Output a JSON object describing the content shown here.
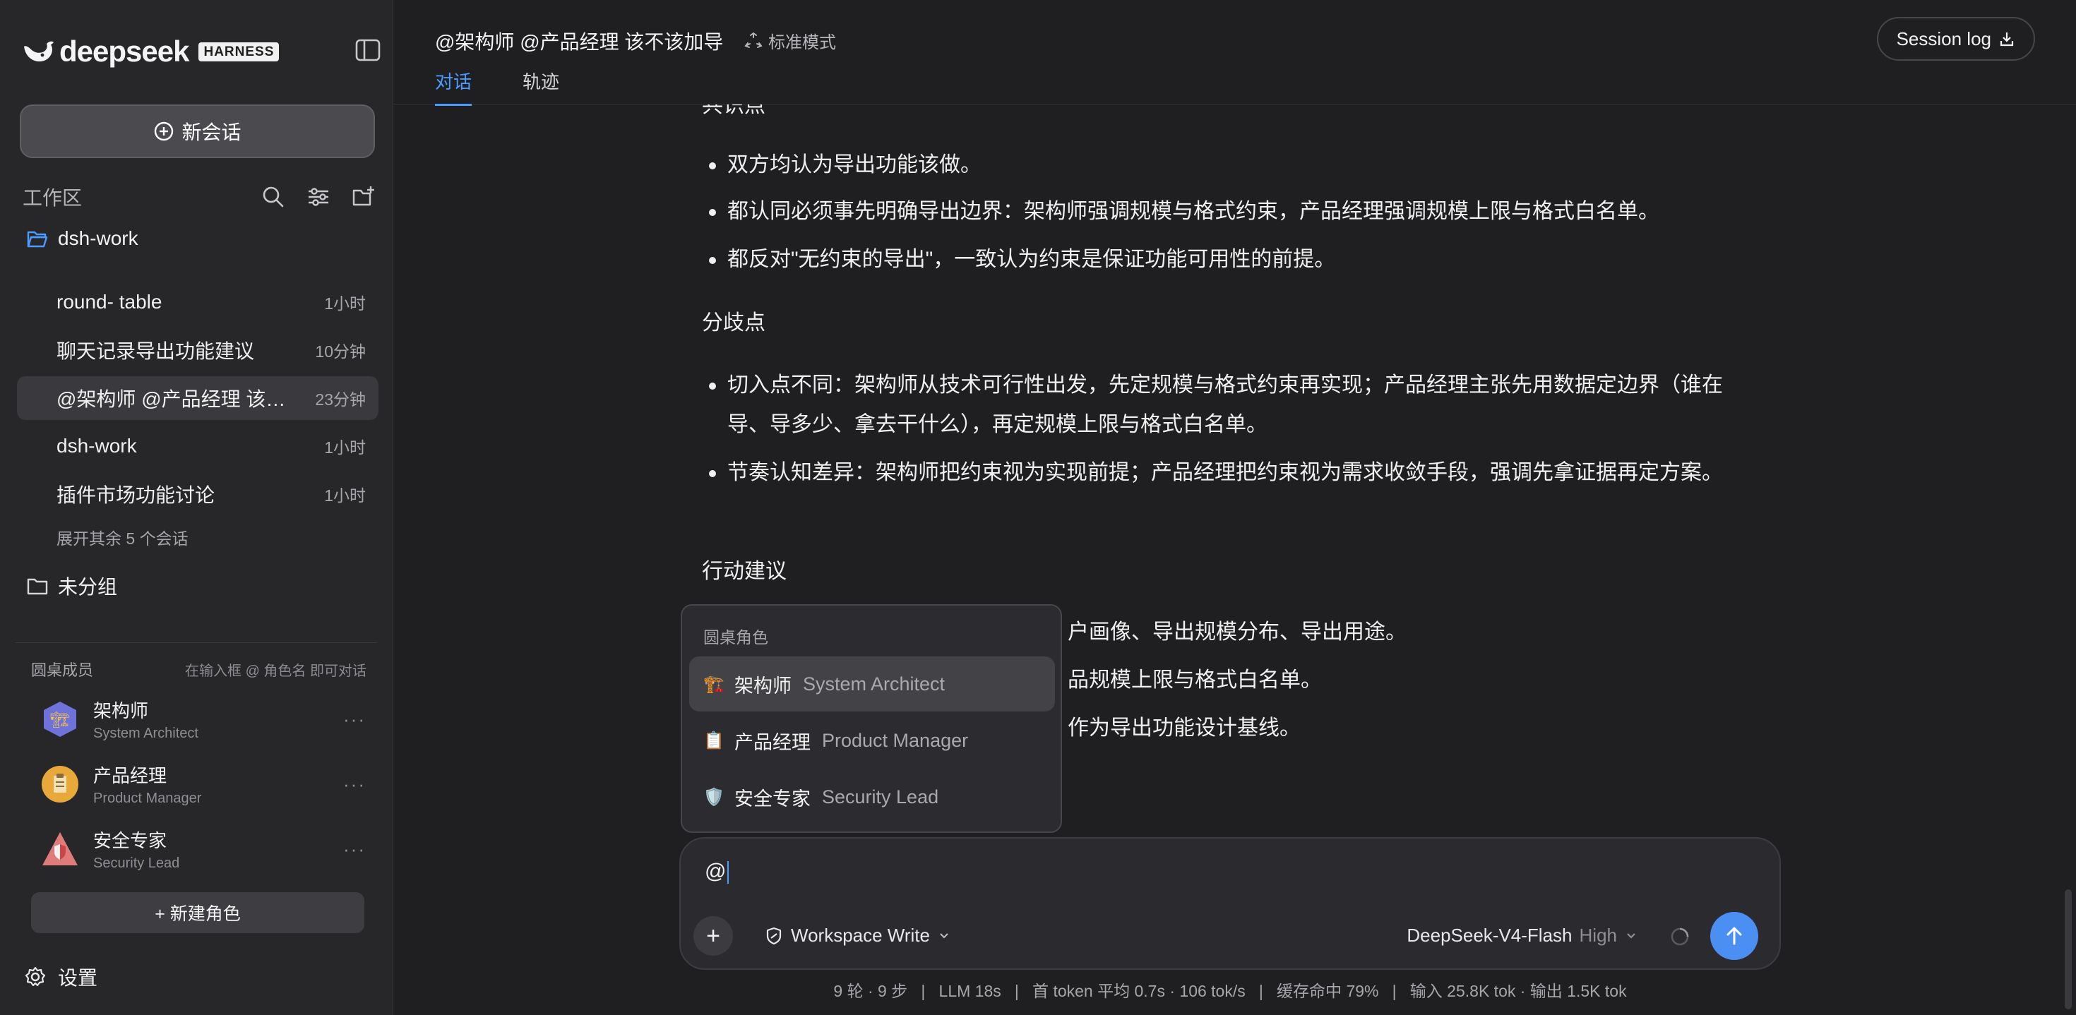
{
  "sidebar": {
    "logo_text": "deepseek",
    "badge": "HARNESS",
    "new_chat": "新会话",
    "workspace_label": "工作区",
    "folder": "dsh-work",
    "conversations": [
      {
        "name": "round- table",
        "time": "1小时"
      },
      {
        "name": "聊天记录导出功能建议",
        "time": "10分钟"
      },
      {
        "name": "@架构师 @产品经理 该不...",
        "time": "23分钟"
      },
      {
        "name": "dsh-work",
        "time": "1小时"
      },
      {
        "name": "插件市场功能讨论",
        "time": "1小时"
      }
    ],
    "expand_more": "展开其余 5 个会话",
    "ungrouped": "未分组",
    "members_title": "圆桌成员",
    "members_hint": "在输入框 @ 角色名 即可对话",
    "members": [
      {
        "name": "架构师",
        "sub": "System Architect",
        "icon": "crane-icon",
        "color": "#7b7fe0"
      },
      {
        "name": "产品经理",
        "sub": "Product Manager",
        "icon": "clipboard-icon",
        "color": "#e8a83a"
      },
      {
        "name": "安全专家",
        "sub": "Security Lead",
        "icon": "shield-icon",
        "color": "#e07b7b"
      }
    ],
    "more": "···",
    "new_role": "+ 新建角色",
    "settings": "设置"
  },
  "header": {
    "title": "@架构师 @产品经理 该不该加导",
    "mode": "标准模式",
    "tabs": [
      "对话",
      "轨迹"
    ],
    "session_log": "Session log"
  },
  "content": {
    "partial_heading": "共识点",
    "consensus": [
      "双方均认为导出功能该做。",
      "都认同必须事先明确导出边界：架构师强调规模与格式约束，产品经理强调规模上限与格式白名单。",
      "都反对\"无约束的导出\"，一致认为约束是保证功能可用性的前提。"
    ],
    "divergence_title": "分歧点",
    "divergence": [
      "切入点不同：架构师从技术可行性出发，先定规模与格式约束再实现；产品经理主张先用数据定边界（谁在导、导多少、拿去干什么），再定规模上限与格式白名单。",
      "节奏认知差异：架构师把约束视为实现前提；产品经理把约束视为需求收敛手段，强调先拿证据再定方案。"
    ],
    "action_title": "行动建议",
    "actions_visible": [
      "户画像、导出规模分布、导出用途。",
      "品规模上限与格式白名单。",
      "作为导出功能设计基线。"
    ]
  },
  "popup": {
    "header": "圆桌角色",
    "options": [
      {
        "icon": "🏗️",
        "cn": "架构师",
        "en": "System Architect"
      },
      {
        "icon": "📋",
        "cn": "产品经理",
        "en": "Product Manager"
      },
      {
        "icon": "🛡️",
        "cn": "安全专家",
        "en": "Security Lead"
      }
    ]
  },
  "composer": {
    "value": "@",
    "permission": "Workspace Write",
    "model": "DeepSeek-V4-Flash",
    "level": "High"
  },
  "stats": "9 轮 · 9 步   |   LLM 18s   |   首 token 平均 0.7s · 106 tok/s   |   缓存命中 79%   |   输入 25.8K tok · 输出 1.5K tok",
  "colors": {
    "accent": "#4c9bff",
    "background": "#1f1f21",
    "sidebar": "#27272a"
  }
}
